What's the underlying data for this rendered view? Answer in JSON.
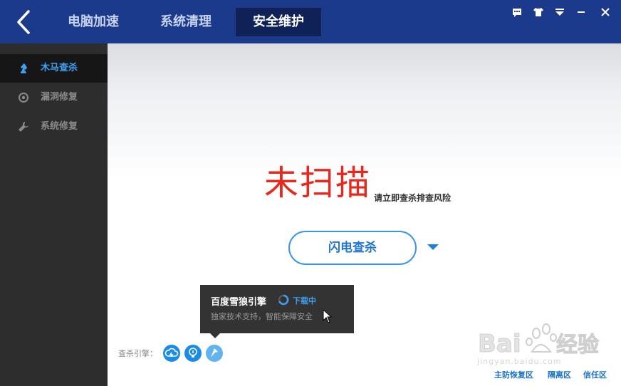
{
  "header": {
    "tabs": [
      {
        "label": "电脑加速"
      },
      {
        "label": "系统清理"
      },
      {
        "label": "安全维护"
      }
    ],
    "active_tab": "安全维护",
    "window_controls": [
      "feedback-icon",
      "skin-icon",
      "menu-icon",
      "minimize-icon",
      "close-icon"
    ]
  },
  "sidebar": {
    "items": [
      {
        "label": "木马查杀",
        "icon": "horse-icon",
        "active": true
      },
      {
        "label": "漏洞修复",
        "icon": "shield-icon",
        "active": false
      },
      {
        "label": "系统修复",
        "icon": "wrench-icon",
        "active": false
      }
    ]
  },
  "main": {
    "status": "未扫描",
    "status_hint": "请立即查杀排查风险",
    "scan_button": "闪电查杀",
    "tooltip": {
      "title": "百度雪狼引擎",
      "status": "下载中",
      "description": "独家技术支持，智能保障安全"
    },
    "engines_label": "查杀引擎：",
    "engines": [
      "cloud-icon",
      "bulb-icon",
      "wolf-icon"
    ],
    "footer_links": [
      "主防恢复区",
      "隔离区",
      "信任区"
    ]
  },
  "watermark": {
    "brand": "Baidu经验",
    "url": "jingyan.baidu.com"
  },
  "colors": {
    "titlebar": "#1b3a8c",
    "active_tab": "#0e2258",
    "sidebar": "#2d2d2d",
    "accent": "#3b96e6",
    "status_red": "#e8281c"
  }
}
